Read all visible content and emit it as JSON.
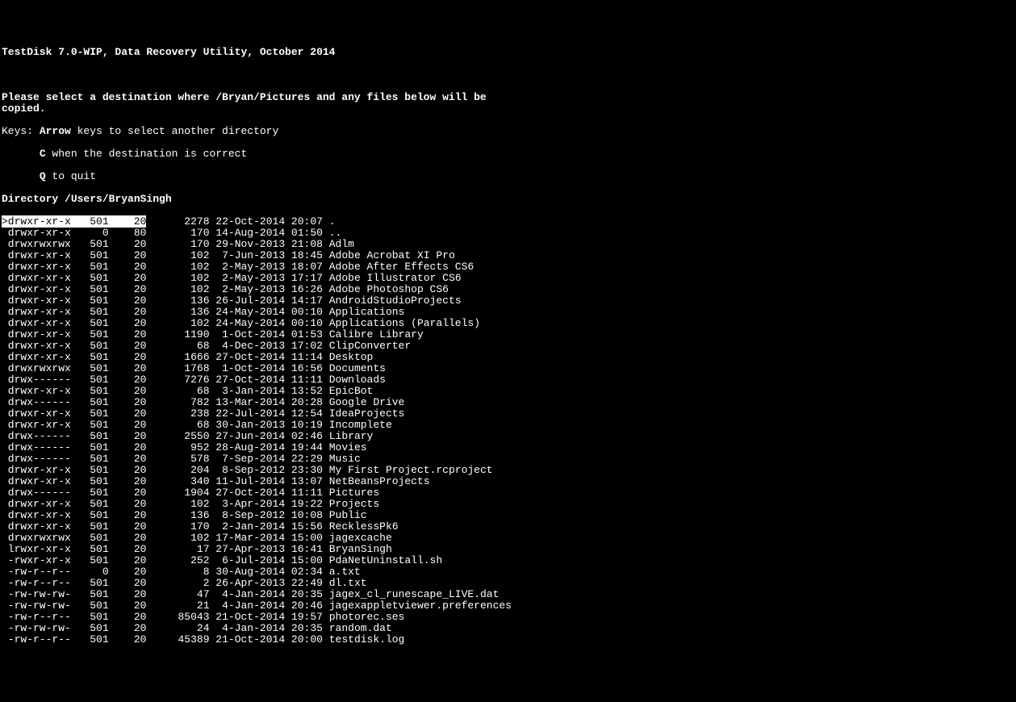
{
  "header": "TestDisk 7.0-WIP, Data Recovery Utility, October 2014",
  "instruction": "Please select a destination where /Bryan/Pictures and any files below will be\ncopied.",
  "keys_label": "Keys: ",
  "keys": [
    {
      "key": "Arrow",
      "desc": " keys to select another directory"
    },
    {
      "key": "C",
      "desc": " when the destination is correct"
    },
    {
      "key": "Q",
      "desc": " to quit"
    }
  ],
  "directory_label": "Directory ",
  "directory_path": "/Users/BryanSingh",
  "selected_index": 0,
  "rows": [
    {
      "perm": "drwxr-xr-x",
      "uid": "501",
      "gid": "20",
      "size": "2278",
      "date": "22-Oct-2014",
      "time": "20:07",
      "name": "."
    },
    {
      "perm": "drwxr-xr-x",
      "uid": "0",
      "gid": "80",
      "size": "170",
      "date": "14-Aug-2014",
      "time": "01:50",
      "name": ".."
    },
    {
      "perm": "drwxrwxrwx",
      "uid": "501",
      "gid": "20",
      "size": "170",
      "date": "29-Nov-2013",
      "time": "21:08",
      "name": "Adlm"
    },
    {
      "perm": "drwxr-xr-x",
      "uid": "501",
      "gid": "20",
      "size": "102",
      "date": " 7-Jun-2013",
      "time": "18:45",
      "name": "Adobe Acrobat XI Pro"
    },
    {
      "perm": "drwxr-xr-x",
      "uid": "501",
      "gid": "20",
      "size": "102",
      "date": " 2-May-2013",
      "time": "18:07",
      "name": "Adobe After Effects CS6"
    },
    {
      "perm": "drwxr-xr-x",
      "uid": "501",
      "gid": "20",
      "size": "102",
      "date": " 2-May-2013",
      "time": "17:17",
      "name": "Adobe Illustrator CS6"
    },
    {
      "perm": "drwxr-xr-x",
      "uid": "501",
      "gid": "20",
      "size": "102",
      "date": " 2-May-2013",
      "time": "16:26",
      "name": "Adobe Photoshop CS6"
    },
    {
      "perm": "drwxr-xr-x",
      "uid": "501",
      "gid": "20",
      "size": "136",
      "date": "26-Jul-2014",
      "time": "14:17",
      "name": "AndroidStudioProjects"
    },
    {
      "perm": "drwxr-xr-x",
      "uid": "501",
      "gid": "20",
      "size": "136",
      "date": "24-May-2014",
      "time": "00:10",
      "name": "Applications"
    },
    {
      "perm": "drwxr-xr-x",
      "uid": "501",
      "gid": "20",
      "size": "102",
      "date": "24-May-2014",
      "time": "00:10",
      "name": "Applications (Parallels)"
    },
    {
      "perm": "drwxr-xr-x",
      "uid": "501",
      "gid": "20",
      "size": "1190",
      "date": " 1-Oct-2014",
      "time": "01:53",
      "name": "Calibre Library"
    },
    {
      "perm": "drwxr-xr-x",
      "uid": "501",
      "gid": "20",
      "size": "68",
      "date": " 4-Dec-2013",
      "time": "17:02",
      "name": "ClipConverter"
    },
    {
      "perm": "drwxr-xr-x",
      "uid": "501",
      "gid": "20",
      "size": "1666",
      "date": "27-Oct-2014",
      "time": "11:14",
      "name": "Desktop"
    },
    {
      "perm": "drwxrwxrwx",
      "uid": "501",
      "gid": "20",
      "size": "1768",
      "date": " 1-Oct-2014",
      "time": "16:56",
      "name": "Documents"
    },
    {
      "perm": "drwx------",
      "uid": "501",
      "gid": "20",
      "size": "7276",
      "date": "27-Oct-2014",
      "time": "11:11",
      "name": "Downloads"
    },
    {
      "perm": "drwxr-xr-x",
      "uid": "501",
      "gid": "20",
      "size": "68",
      "date": " 3-Jan-2014",
      "time": "13:52",
      "name": "EpicBot"
    },
    {
      "perm": "drwx------",
      "uid": "501",
      "gid": "20",
      "size": "782",
      "date": "13-Mar-2014",
      "time": "20:28",
      "name": "Google Drive"
    },
    {
      "perm": "drwxr-xr-x",
      "uid": "501",
      "gid": "20",
      "size": "238",
      "date": "22-Jul-2014",
      "time": "12:54",
      "name": "IdeaProjects"
    },
    {
      "perm": "drwxr-xr-x",
      "uid": "501",
      "gid": "20",
      "size": "68",
      "date": "30-Jan-2013",
      "time": "10:19",
      "name": "Incomplete"
    },
    {
      "perm": "drwx------",
      "uid": "501",
      "gid": "20",
      "size": "2550",
      "date": "27-Jun-2014",
      "time": "02:46",
      "name": "Library"
    },
    {
      "perm": "drwx------",
      "uid": "501",
      "gid": "20",
      "size": "952",
      "date": "28-Aug-2014",
      "time": "19:44",
      "name": "Movies"
    },
    {
      "perm": "drwx------",
      "uid": "501",
      "gid": "20",
      "size": "578",
      "date": " 7-Sep-2014",
      "time": "22:29",
      "name": "Music"
    },
    {
      "perm": "drwxr-xr-x",
      "uid": "501",
      "gid": "20",
      "size": "204",
      "date": " 8-Sep-2012",
      "time": "23:30",
      "name": "My First Project.rcproject"
    },
    {
      "perm": "drwxr-xr-x",
      "uid": "501",
      "gid": "20",
      "size": "340",
      "date": "11-Jul-2014",
      "time": "13:07",
      "name": "NetBeansProjects"
    },
    {
      "perm": "drwx------",
      "uid": "501",
      "gid": "20",
      "size": "1904",
      "date": "27-Oct-2014",
      "time": "11:11",
      "name": "Pictures"
    },
    {
      "perm": "drwxr-xr-x",
      "uid": "501",
      "gid": "20",
      "size": "102",
      "date": " 3-Apr-2014",
      "time": "19:22",
      "name": "Projects"
    },
    {
      "perm": "drwxr-xr-x",
      "uid": "501",
      "gid": "20",
      "size": "136",
      "date": " 8-Sep-2012",
      "time": "10:08",
      "name": "Public"
    },
    {
      "perm": "drwxr-xr-x",
      "uid": "501",
      "gid": "20",
      "size": "170",
      "date": " 2-Jan-2014",
      "time": "15:56",
      "name": "RecklessPk6"
    },
    {
      "perm": "drwxrwxrwx",
      "uid": "501",
      "gid": "20",
      "size": "102",
      "date": "17-Mar-2014",
      "time": "15:00",
      "name": "jagexcache"
    },
    {
      "perm": "lrwxr-xr-x",
      "uid": "501",
      "gid": "20",
      "size": "17",
      "date": "27-Apr-2013",
      "time": "16:41",
      "name": "BryanSingh"
    },
    {
      "perm": "-rwxr-xr-x",
      "uid": "501",
      "gid": "20",
      "size": "252",
      "date": " 6-Jul-2014",
      "time": "15:00",
      "name": "PdaNetUninstall.sh"
    },
    {
      "perm": "-rw-r--r--",
      "uid": "0",
      "gid": "20",
      "size": "8",
      "date": "30-Aug-2014",
      "time": "02:34",
      "name": "a.txt"
    },
    {
      "perm": "-rw-r--r--",
      "uid": "501",
      "gid": "20",
      "size": "2",
      "date": "26-Apr-2013",
      "time": "22:49",
      "name": "dl.txt"
    },
    {
      "perm": "-rw-rw-rw-",
      "uid": "501",
      "gid": "20",
      "size": "47",
      "date": " 4-Jan-2014",
      "time": "20:35",
      "name": "jagex_cl_runescape_LIVE.dat"
    },
    {
      "perm": "-rw-rw-rw-",
      "uid": "501",
      "gid": "20",
      "size": "21",
      "date": " 4-Jan-2014",
      "time": "20:46",
      "name": "jagexappletviewer.preferences"
    },
    {
      "perm": "-rw-r--r--",
      "uid": "501",
      "gid": "20",
      "size": "85043",
      "date": "21-Oct-2014",
      "time": "19:57",
      "name": "photorec.ses"
    },
    {
      "perm": "-rw-rw-rw-",
      "uid": "501",
      "gid": "20",
      "size": "24",
      "date": " 4-Jan-2014",
      "time": "20:35",
      "name": "random.dat"
    },
    {
      "perm": "-rw-r--r--",
      "uid": "501",
      "gid": "20",
      "size": "45389",
      "date": "21-Oct-2014",
      "time": "20:00",
      "name": "testdisk.log"
    }
  ]
}
